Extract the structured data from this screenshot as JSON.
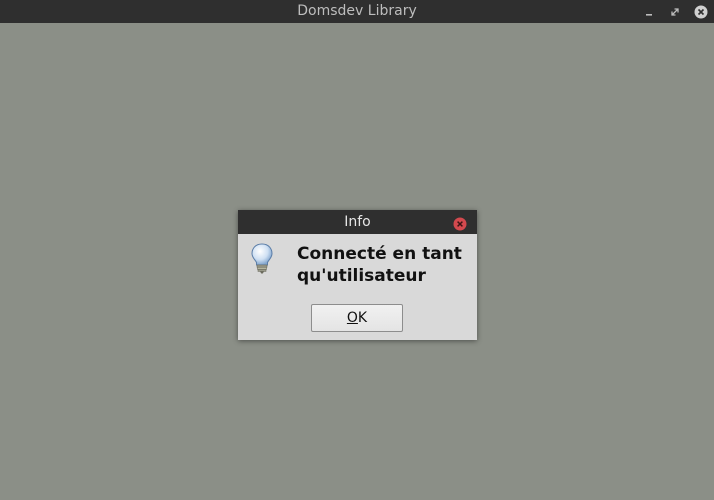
{
  "window": {
    "title": "Domsdev Library",
    "controls": {
      "minimize_icon": "minimize-icon",
      "maximize_icon": "maximize-icon",
      "close_icon": "close-icon"
    }
  },
  "dialog": {
    "title": "Info",
    "icon": "lightbulb-icon",
    "message_line1": "Connecté en tant",
    "message_line2": "qu'utilisateur",
    "ok_mnemonic": "O",
    "ok_rest": "K"
  },
  "colors": {
    "background": "#8b8f87",
    "titlebar": "#2f2f2f",
    "dialog_bg": "#d9d9d9",
    "close_red": "#d3494e"
  }
}
